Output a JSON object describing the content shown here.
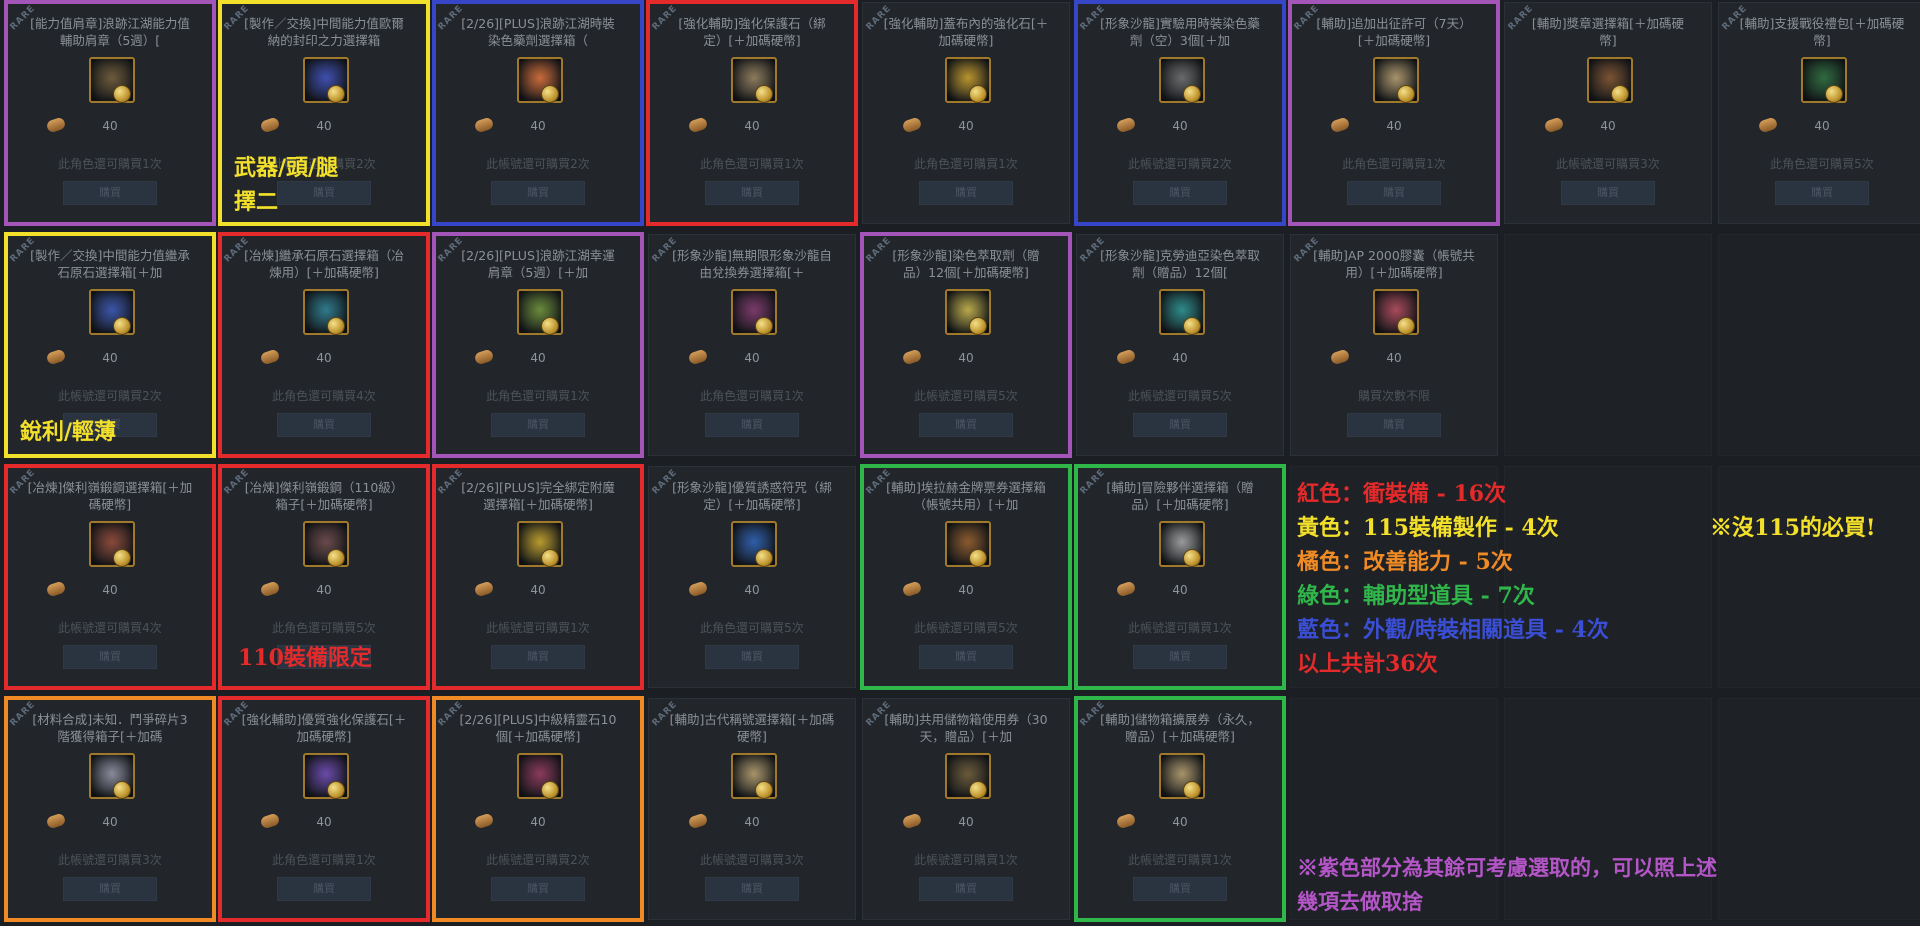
{
  "currency_amount": "40",
  "buy_label": "購買",
  "rare_tag": "RARE",
  "rows": [
    [
      {
        "name": "[能力值肩章]浪跡江湖能力值輔助肩章（5週）[",
        "limit": "此角色還可購買1次",
        "icon": "shoulder-badge-icon",
        "icon_color": "#6d5a3a"
      },
      {
        "name": "[製作／交換]中間能力值歐爾納的封印之力選擇箱",
        "limit": "此帳號還可購買2次",
        "icon": "seal-box-icon",
        "icon_color": "#3e4fae"
      },
      {
        "name": "[2/26][PLUS]浪跡江湖時裝染色藥劑選擇箱（",
        "limit": "此帳號還可購買2次",
        "icon": "dye-box-icon",
        "icon_color": "#c86a3a"
      },
      {
        "name": "[強化輔助]強化保護石（綁定）[＋加碼硬幣]",
        "limit": "此角色還可購買1次",
        "icon": "protection-stone-icon",
        "icon_color": "#8c7a5c"
      },
      {
        "name": "[強化輔助]蓋布內的強化石[＋加碼硬幣]",
        "limit": "此角色還可購買1次",
        "icon": "enhance-stone-icon",
        "icon_color": "#b8932e"
      },
      {
        "name": "[形象沙龍]實驗用時裝染色藥劑（空）3個[＋加",
        "limit": "此帳號還可購買2次",
        "icon": "dye-bottle-icon",
        "icon_color": "#6a6a6a"
      },
      {
        "name": "[輔助]追加出征許可（7天）[＋加碼硬幣]",
        "limit": "此角色還可購買1次",
        "icon": "scroll-permit-icon",
        "icon_color": "#a8946a"
      },
      {
        "name": "[輔助]獎章選擇箱[＋加碼硬幣]",
        "limit": "此帳號還可購買3次",
        "icon": "medal-box-icon",
        "icon_color": "#7a5232"
      },
      {
        "name": "[輔助]支援戰役禮包[＋加碼硬幣]",
        "limit": "此角色還可購買5次",
        "icon": "gift-pack-icon",
        "icon_color": "#2f6a3e"
      }
    ],
    [
      {
        "name": "[製作／交換]中間能力值繼承石原石選擇箱[＋加",
        "limit": "此帳號還可購買2次",
        "icon": "inherit-stone-box-icon",
        "icon_color": "#3b55a8"
      },
      {
        "name": "[冶煉]繼承石原石選擇箱（冶煉用）[＋加碼硬幣]",
        "limit": "此角色還可購買4次",
        "icon": "smelt-bag-icon",
        "icon_color": "#2f7a8a"
      },
      {
        "name": "[2/26][PLUS]浪跡江湖幸運肩章（5週）[＋加",
        "limit": "此角色還可購買1次",
        "icon": "lucky-badge-icon",
        "icon_color": "#6a8a3a"
      },
      {
        "name": "[形象沙龍]無期限形象沙龍自由兌換券選擇箱[＋",
        "limit": "此角色還可購買1次",
        "icon": "salon-ticket-icon",
        "icon_color": "#7a3a6a"
      },
      {
        "name": "[形象沙龍]染色萃取劑（贈品）12個[＋加碼硬幣]",
        "limit": "此帳號還可購買5次",
        "icon": "dye-extract-icon",
        "icon_color": "#b8a84a"
      },
      {
        "name": "[形象沙龍]克勞迪亞染色萃取劑（贈品）12個[",
        "limit": "此帳號還可購買5次",
        "icon": "claudia-extract-icon",
        "icon_color": "#2f8a8a"
      },
      {
        "name": "[輔助]AP 2000膠囊（帳號共用）[＋加碼硬幣]",
        "limit": "購買次數不限",
        "icon": "ap-capsule-icon",
        "icon_color": "#a84a5a"
      },
      null,
      null
    ],
    [
      {
        "name": "[冶煉]傑利嶺鍛鋼選擇箱[＋加碼硬幣]",
        "limit": "此帳號還可購買4次",
        "icon": "steel-box-icon",
        "icon_color": "#8a4a3a"
      },
      {
        "name": "[冶煉]傑利嶺鍛鋼（110級）箱子[＋加碼硬幣]",
        "limit": "此角色還可購買5次",
        "icon": "steel-chest-icon",
        "icon_color": "#6a4a4a"
      },
      {
        "name": "[2/26][PLUS]完全綁定附魔選擇箱[＋加碼硬幣]",
        "limit": "此帳號還可購買1次",
        "icon": "enchant-box-icon",
        "icon_color": "#b89a2e"
      },
      {
        "name": "[形象沙龍]優質誘惑符咒（綁定）[＋加碼硬幣]",
        "limit": "此角色還可購買5次",
        "icon": "charm-icon",
        "icon_color": "#2f5ea8"
      },
      {
        "name": "[輔助]埃拉赫金牌票券選擇箱（帳號共用）[＋加",
        "limit": "此帳號還可購買5次",
        "icon": "ticket-box-icon",
        "icon_color": "#8a5a2e"
      },
      {
        "name": "[輔助]冒險夥伴選擇箱（贈品）[＋加碼硬幣]",
        "limit": "此帳號還可購買1次",
        "icon": "companion-bag-icon",
        "icon_color": "#9a9a9a"
      },
      null,
      null,
      null
    ],
    [
      {
        "name": "[材料合成]未知．鬥爭碎片3階獲得箱子[＋加碼",
        "limit": "此帳號還可購買3次",
        "icon": "fragment-box-icon",
        "icon_color": "#8a8a9a"
      },
      {
        "name": "[強化輔助]優質強化保護石[＋加碼硬幣]",
        "limit": "此角色還可購買1次",
        "icon": "premium-stone-icon",
        "icon_color": "#6a4aa8"
      },
      {
        "name": "[2/26][PLUS]中級精靈石10個[＋加碼硬幣]",
        "limit": "此帳號還可購買2次",
        "icon": "spirit-stone-icon",
        "icon_color": "#8a3a5a"
      },
      {
        "name": "[輔助]古代稱號選擇箱[＋加碼硬幣]",
        "limit": "此帳號還可購買3次",
        "icon": "title-box-icon",
        "icon_color": "#a8946a"
      },
      {
        "name": "[輔助]共用儲物箱使用券（30天，贈品）[＋加",
        "limit": "此帳號還可購買1次",
        "icon": "storage-ticket-icon",
        "icon_color": "#6a5a3a"
      },
      {
        "name": "[輔助]儲物箱擴展券（永久，贈品）[＋加碼硬幣]",
        "limit": "此帳號還可購買1次",
        "icon": "expand-ticket-icon",
        "icon_color": "#a8946a"
      },
      null,
      null,
      null
    ]
  ],
  "frames": [
    {
      "row": 0,
      "col": 0,
      "color": "purple"
    },
    {
      "row": 0,
      "col": 1,
      "color": "yellow"
    },
    {
      "row": 0,
      "col": 2,
      "color": "blue"
    },
    {
      "row": 0,
      "col": 3,
      "color": "red"
    },
    {
      "row": 0,
      "col": 5,
      "color": "blue"
    },
    {
      "row": 0,
      "col": 6,
      "color": "purple"
    },
    {
      "row": 1,
      "col": 0,
      "color": "yellow"
    },
    {
      "row": 1,
      "col": 1,
      "color": "red"
    },
    {
      "row": 1,
      "col": 2,
      "color": "purple"
    },
    {
      "row": 1,
      "col": 4,
      "color": "purple"
    },
    {
      "row": 2,
      "col": 0,
      "color": "red"
    },
    {
      "row": 2,
      "col": 1,
      "color": "red"
    },
    {
      "row": 2,
      "col": 2,
      "color": "red"
    },
    {
      "row": 2,
      "col": 4,
      "color": "green"
    },
    {
      "row": 2,
      "col": 5,
      "color": "green"
    },
    {
      "row": 3,
      "col": 0,
      "color": "orange"
    },
    {
      "row": 3,
      "col": 1,
      "color": "red"
    },
    {
      "row": 3,
      "col": 2,
      "color": "orange"
    },
    {
      "row": 3,
      "col": 5,
      "color": "green"
    }
  ],
  "annotations": {
    "weapon_head_leg": "武器/頭/腿",
    "choose_two": "擇二",
    "sharp_light": "銳利/輕薄",
    "gear_110_only": "110裝備限定"
  },
  "legend": {
    "red": "紅色：衝裝備 - 16次",
    "yellow": "黃色：115裝備製作 - 4次",
    "must_buy": "※沒115的必買!",
    "orange": "橘色：改善能力 - 5次",
    "green": "綠色：輔助型道具 - 7次",
    "blue": "藍色：外觀/時裝相關道具 - 4次",
    "total": "以上共計36次",
    "note_line1": "※紫色部分為其餘可考慮選取的，可以照上述",
    "note_line2": "幾項去做取捨"
  },
  "colors": {
    "red": "#e42a2a",
    "yellow": "#f3e02a",
    "orange": "#f08a24",
    "green": "#2fb74a",
    "blue": "#3a4fd6",
    "purple": "#b455c8"
  }
}
